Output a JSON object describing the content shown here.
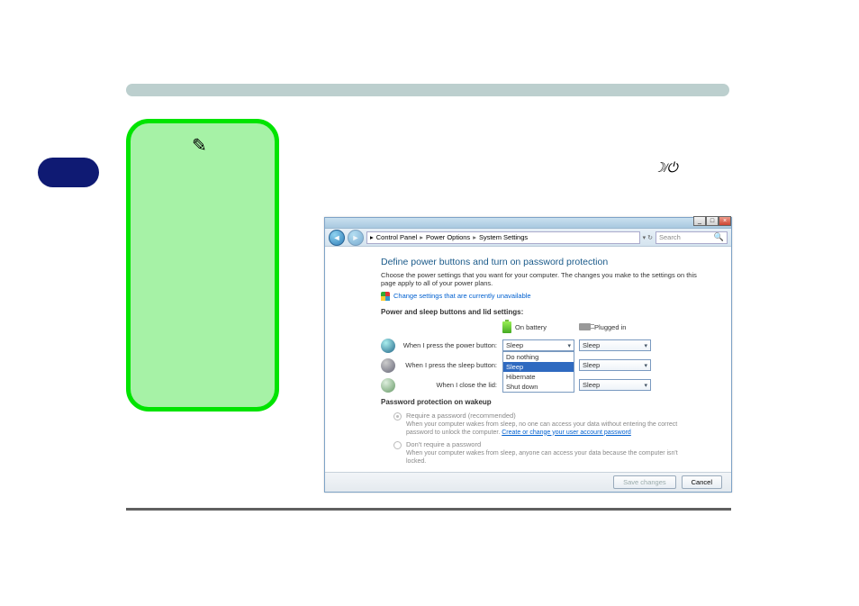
{
  "breadcrumb": {
    "a": "Control Panel",
    "b": "Power Options",
    "c": "System Settings"
  },
  "search": {
    "placeholder": "Search"
  },
  "page": {
    "title": "Define power buttons and turn on password protection",
    "desc": "Choose the power settings that you want for your computer. The changes you make to the settings on this page apply to all of your power plans.",
    "shield_link": "Change settings that are currently unavailable",
    "section_buttons": "Power and sleep buttons and lid settings:",
    "col_battery": "On battery",
    "col_plugged": "Plugged in",
    "row_power_label": "When I press the power button:",
    "row_sleep_label": "When I press the sleep button:",
    "row_lid_label": "When I close the lid:",
    "dd_value_sleep": "Sleep",
    "dd_opt_donothing": "Do nothing",
    "dd_opt_sleep": "Sleep",
    "dd_opt_hibernate": "Hibernate",
    "dd_opt_shutdown": "Shut down",
    "section_password": "Password protection on wakeup",
    "radio_require": "Require a password (recommended)",
    "radio_require_desc_a": "When your computer wakes from sleep, no one can access your data without entering the correct password to unlock the computer. ",
    "radio_require_link": "Create or change your user account password",
    "radio_dont": "Don't require a password",
    "radio_dont_desc": "When your computer wakes from sleep, anyone can access your data because the computer isn't locked."
  },
  "buttons": {
    "save": "Save changes",
    "cancel": "Cancel"
  },
  "win_ctrls": {
    "min": "_",
    "max": "□",
    "close": "×"
  }
}
